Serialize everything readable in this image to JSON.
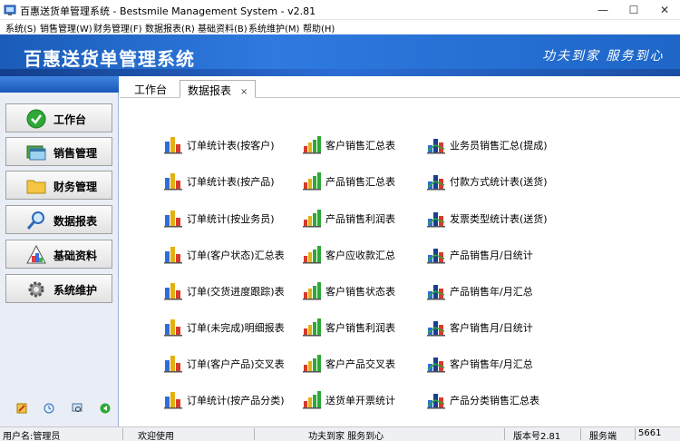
{
  "window": {
    "title": "百惠送货单管理系统 - Bestsmile Management System - v2.81",
    "minimize_label": "—",
    "maximize_label": "☐",
    "close_label": "✕"
  },
  "menu": [
    {
      "label": "系统(S)"
    },
    {
      "label": "销售管理(W)"
    },
    {
      "label": "财务管理(F)"
    },
    {
      "label": "数据报表(R)"
    },
    {
      "label": "基础资料(B)"
    },
    {
      "label": "系统维护(M)"
    },
    {
      "label": "帮助(H)"
    }
  ],
  "banner": {
    "title": "百惠送货单管理系统",
    "slogan": "功夫到家 服务到心"
  },
  "sidebar": {
    "items": [
      {
        "label": "工作台",
        "icon": "check-circle-icon"
      },
      {
        "label": "销售管理",
        "icon": "sales-window-icon"
      },
      {
        "label": "财务管理",
        "icon": "folder-icon"
      },
      {
        "label": "数据报表",
        "icon": "magnifier-icon"
      },
      {
        "label": "基础资料",
        "icon": "color-palette-icon"
      },
      {
        "label": "系统维护",
        "icon": "gear-icon"
      }
    ],
    "bottom_icons": [
      "edit-icon",
      "clock-icon",
      "search-window-icon",
      "green-arrow-icon"
    ]
  },
  "tabs": [
    {
      "label": "工作台"
    },
    {
      "label": "数据报表",
      "close": "×"
    }
  ],
  "reports": {
    "col1": [
      "订单统计表(按客户)",
      "订单统计表(按产品)",
      "订单统计(按业务员)",
      "订单(客户状态)汇总表",
      "订单(交货进度跟踪)表",
      "订单(未完成)明细报表",
      "订单(客户产品)交叉表",
      "订单统计(按产品分类)"
    ],
    "col2": [
      "客户销售汇总表",
      "产品销售汇总表",
      "产品销售利润表",
      "客户应收款汇总",
      "客户销售状态表",
      "客户销售利润表",
      "客户产品交叉表",
      "送货单开票统计"
    ],
    "col3": [
      "业务员销售汇总(提成)",
      "付款方式统计表(送货)",
      "发票类型统计表(送货)",
      "产品销售月/日统计",
      "产品销售年/月汇总",
      "客户销售月/日统计",
      "客户销售年/月汇总",
      "产品分类销售汇总表"
    ]
  },
  "status": {
    "user": "用户名:管理员",
    "welcome": "欢迎使用",
    "slogan": "功夫到家 服务到心",
    "version": "版本号2.81",
    "server": "服务端",
    "code": "5661"
  },
  "colors": {
    "banner": "#1e66c8",
    "sidebar_bg": "#e9eef6"
  }
}
